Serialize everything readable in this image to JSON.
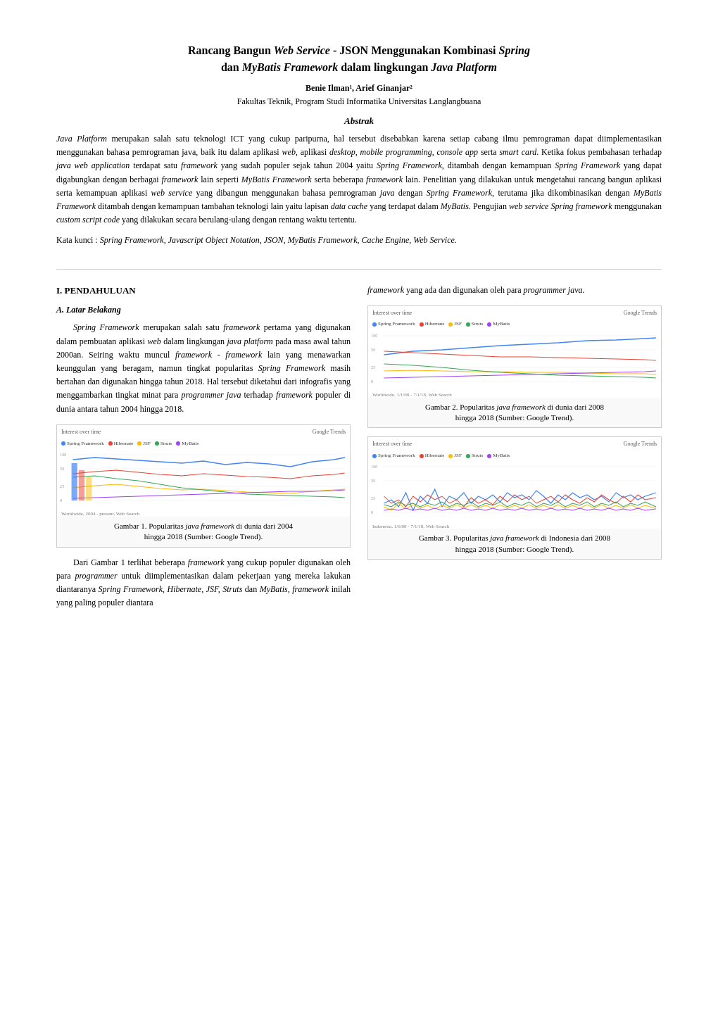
{
  "title": {
    "line1": "Rancang Bangun Web Service - JSON Menggunakan Kombinasi Spring",
    "line2": "dan MyBatis Framework dalam lingkungan Java Platform",
    "line1_parts": [
      {
        "text": "Rancang Bangun ",
        "bold": true,
        "italic": false
      },
      {
        "text": "Web Service",
        "bold": true,
        "italic": true
      },
      {
        "text": " - ",
        "bold": true,
        "italic": false
      },
      {
        "text": "JSON",
        "bold": true,
        "italic": false
      },
      {
        "text": " Menggunakan Kombinasi ",
        "bold": true,
        "italic": false
      },
      {
        "text": "Spring",
        "bold": true,
        "italic": true
      }
    ],
    "line2_parts": [
      {
        "text": "dan ",
        "bold": true,
        "italic": false
      },
      {
        "text": "MyBatis Framework",
        "bold": true,
        "italic": true
      },
      {
        "text": " dalam lingkungan ",
        "bold": true,
        "italic": false
      },
      {
        "text": "Java Platform",
        "bold": true,
        "italic": true
      }
    ]
  },
  "authors": {
    "names": "Benie Ilman¹, Arief Ginanjar²",
    "affiliation": "Fakultas Teknik, Program Studi Informatika Universitas Langlangbuana"
  },
  "abstract": {
    "heading": "Abstrak",
    "text": "Java Platform merupakan salah satu teknologi ICT yang cukup paripurna, hal tersebut disebabkan karena setiap cabang ilmu pemrograman dapat diimplementasikan menggunakan bahasa pemrograman java, baik itu dalam aplikasi web, aplikasi desktop, mobile programming, console app serta smart card. Ketika fokus pembahasan terhadap java web application terdapat satu framework yang sudah populer sejak tahun 2004 yaitu Spring Framework, ditambah dengan kemampuan Spring Framework yang dapat digabungkan dengan berbagai framework lain seperti MyBatis Framework serta beberapa framework lain. Penelitian yang dilakukan untuk mengetahui rancang bangun aplikasi serta kemampuan aplikasi web service yang dibangun menggunakan bahasa pemrograman java dengan Spring Framework, terutama jika dikombinasikan dengan MyBatis Framework ditambah dengan kemampuan tambahan teknologi lain yaitu lapisan data cache yang terdapat dalam MyBatis. Pengujian web service Spring framework menggunakan custom script code yang dilakukan secara berulang-ulang dengan rentang waktu tertentu."
  },
  "keywords": {
    "label": "Kata kunci : ",
    "text": "Spring Framework, Javascript Object Notation, JSON, MyBatis Framework, Cache Engine, Web Service."
  },
  "left_column": {
    "section": "I. PENDAHULUAN",
    "subsection": "A. Latar Belakang",
    "paragraph1": "Spring Framework merupakan salah satu framework pertama yang digunakan dalam pembuatan aplikasi web dalam lingkungan java platform pada masa awal tahun 2000an. Seiring waktu muncul framework - framework lain yang menawarkan keunggulan yang beragam, namun tingkat popularitas Spring Framework masih bertahan dan digunakan hingga tahun 2018. Hal tersebut diketahui dari infografis yang menggambarkan tingkat minat para programmer java terhadap framework populer di dunia antara tahun 2004 hingga 2018.",
    "figure1_caption": "Gambar 1. Popularitas java framework di dunia dari 2004\nhingga 2018 (Sumber: Google Trend).",
    "paragraph2": "Dari Gambar 1 terlihat beberapa framework yang cukup populer digunakan oleh para programmer untuk diimplementasikan dalam pekerjaan yang mereka lakukan diantaranya Spring Framework, Hibernate, JSF, Struts dan MyBatis, framework inilah yang paling populer diantara"
  },
  "right_column": {
    "text_before_fig2": "framework yang ada dan digunakan oleh para programmer java.",
    "figure2_caption": "Gambar 2. Popularitas java framework di dunia dari 2008\nhingga 2018 (Sumber: Google Trend).",
    "figure3_caption": "Gambar 3. Popularitas java framework di Indonesia dari 2008\nhingga 2018 (Sumber: Google Trend)."
  },
  "chart_labels": {
    "interest": "Interest over time",
    "google_trends": "Google Trends",
    "legend": [
      "Spring Framework",
      "Hibernate",
      "JSF",
      "Struts",
      "MyBatis"
    ],
    "colors": [
      "#4285f4",
      "#ea4335",
      "#fbbc04",
      "#34a853",
      "#a142f4"
    ],
    "footer1": "Worldwide, 2004 - present, Web Search",
    "footer2": "Worldwide, 1/1/08 - 7/1/18, Web Search",
    "footer3": "Indonesia, 1/6/08 - 7/1/18, Web Search"
  }
}
